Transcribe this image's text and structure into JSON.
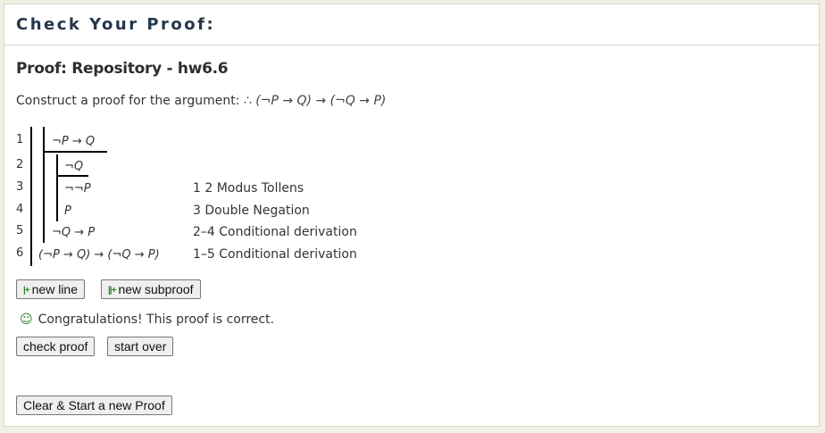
{
  "header": {
    "title": "Check Your Proof:"
  },
  "proof_title": "Proof: Repository - hw6.6",
  "prompt": {
    "text": "Construct a proof for the argument: ",
    "argument": "∴ (¬P → Q) → (¬Q → P)"
  },
  "lines": [
    {
      "num": "1",
      "formula": "¬P → Q",
      "justification": ""
    },
    {
      "num": "2",
      "formula": "¬Q",
      "justification": ""
    },
    {
      "num": "3",
      "formula": "¬¬P",
      "justification": "1 2 Modus Tollens"
    },
    {
      "num": "4",
      "formula": "P",
      "justification": "3 Double Negation"
    },
    {
      "num": "5",
      "formula": "¬Q → P",
      "justification": "2–4 Conditional derivation"
    },
    {
      "num": "6",
      "formula": "(¬P → Q) → (¬Q → P)",
      "justification": "1–5 Conditional derivation"
    }
  ],
  "buttons": {
    "new_line": "new line",
    "new_subproof": "new subproof",
    "check_proof": "check proof",
    "start_over": "start over",
    "clear_new": "Clear & Start a new Proof"
  },
  "status": {
    "message": "Congratulations! This proof is correct.",
    "icon": "smiley-icon"
  },
  "colors": {
    "accent_icon": "#2a8a2a",
    "title": "#24364a"
  }
}
